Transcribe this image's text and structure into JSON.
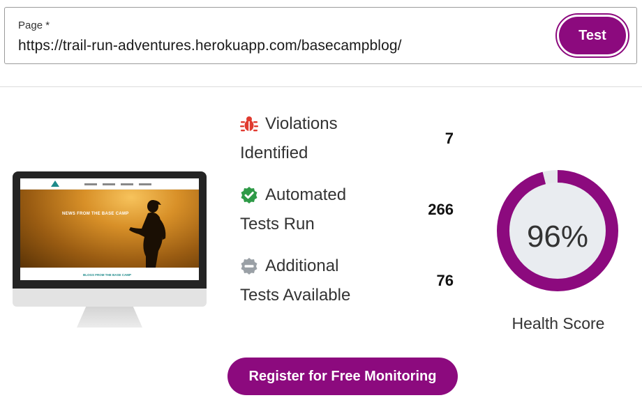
{
  "url_form": {
    "label": "Page *",
    "value": "https://trail-run-adventures.herokuapp.com/basecampblog/",
    "test_button": "Test"
  },
  "preview": {
    "hero_text": "NEWS FROM THE BASE CAMP",
    "footer_text": "BLOGS FROM THE BASE CAMP"
  },
  "stats": [
    {
      "line1": "Violations",
      "line2": "Identified",
      "value": "7",
      "icon": "bug-icon",
      "color": "#e03a2f"
    },
    {
      "line1": "Automated",
      "line2": "Tests Run",
      "value": "266",
      "icon": "check-badge-icon",
      "color": "#2e9a47"
    },
    {
      "line1": "Additional",
      "line2": "Tests Available",
      "value": "76",
      "icon": "minus-circle-icon",
      "color": "#9aa0a6"
    }
  ],
  "health": {
    "score_text": "96%",
    "score_fraction": 0.96,
    "label": "Health Score",
    "ring_color": "#8c0a7e",
    "track_color": "#e6e8ec"
  },
  "register_button": "Register for Free Monitoring",
  "colors": {
    "accent": "#8c0a7e"
  }
}
